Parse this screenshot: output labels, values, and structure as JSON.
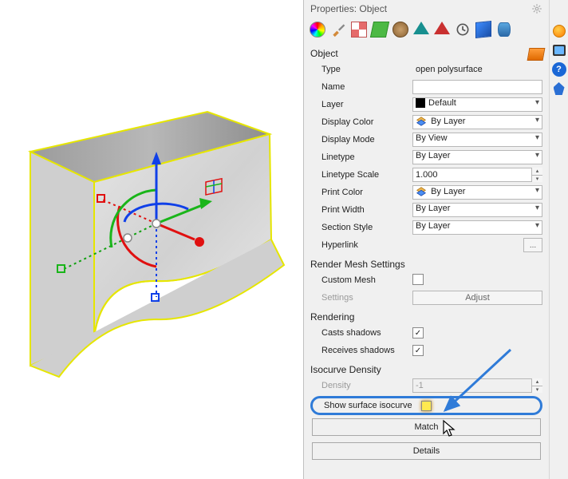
{
  "panel": {
    "title": "Properties: Object",
    "sections": {
      "object": {
        "title": "Object",
        "type_label": "Type",
        "type_value": "open polysurface",
        "name_label": "Name",
        "name_value": "",
        "layer_label": "Layer",
        "layer_value": "Default",
        "display_color_label": "Display Color",
        "display_color_value": "By Layer",
        "display_mode_label": "Display Mode",
        "display_mode_value": "By View",
        "linetype_label": "Linetype",
        "linetype_value": "By Layer",
        "linetype_scale_label": "Linetype Scale",
        "linetype_scale_value": "1.000",
        "print_color_label": "Print Color",
        "print_color_value": "By Layer",
        "print_width_label": "Print Width",
        "print_width_value": "By Layer",
        "section_style_label": "Section Style",
        "section_style_value": "By Layer",
        "hyperlink_label": "Hyperlink",
        "hyperlink_btn": "..."
      },
      "render_mesh": {
        "title": "Render Mesh Settings",
        "custom_mesh_label": "Custom Mesh",
        "custom_mesh_checked": false,
        "settings_label": "Settings",
        "adjust_btn": "Adjust"
      },
      "rendering": {
        "title": "Rendering",
        "casts_label": "Casts shadows",
        "casts_checked": true,
        "receives_label": "Receives shadows",
        "receives_checked": true
      },
      "isocurve": {
        "title": "Isocurve Density",
        "density_label": "Density",
        "density_value": "-1",
        "show_label": "Show surface isocurve",
        "show_checked": false
      }
    },
    "buttons": {
      "match": "Match",
      "details": "Details"
    }
  }
}
